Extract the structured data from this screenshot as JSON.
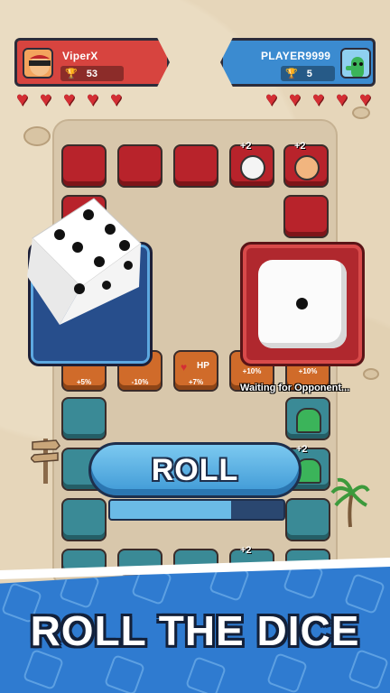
{
  "player_left": {
    "name": "ViperX",
    "trophies": "53",
    "hearts": 5,
    "color": "#d7443f"
  },
  "player_right": {
    "name": "PLAYER9999",
    "trophies": "5",
    "hearts": 5,
    "color": "#3b8bd0"
  },
  "tiles_top": [
    {
      "type": "red",
      "badge": ""
    },
    {
      "type": "red",
      "badge": ""
    },
    {
      "type": "red",
      "badge": ""
    },
    {
      "type": "red",
      "badge": "+2"
    },
    {
      "type": "red",
      "badge": "+2"
    }
  ],
  "tiles_buff": [
    {
      "label": "+5%"
    },
    {
      "label": "-10%"
    },
    {
      "label": "+7%",
      "title": "HP"
    },
    {
      "label": "+10%"
    },
    {
      "label": "+10%"
    }
  ],
  "badges_lower": [
    "+2",
    "+2"
  ],
  "dice": {
    "player_left_value": 4,
    "opponent_value": 1
  },
  "status": {
    "waiting": "Waiting for Opponent..."
  },
  "roll_button": {
    "label": "ROLL",
    "progress": 0.7
  },
  "banner": {
    "title": "ROLL THE DICE"
  },
  "icons": [
    "heart-icon",
    "trophy-icon",
    "dice-icon",
    "palm-tree-icon",
    "signpost-icon"
  ]
}
